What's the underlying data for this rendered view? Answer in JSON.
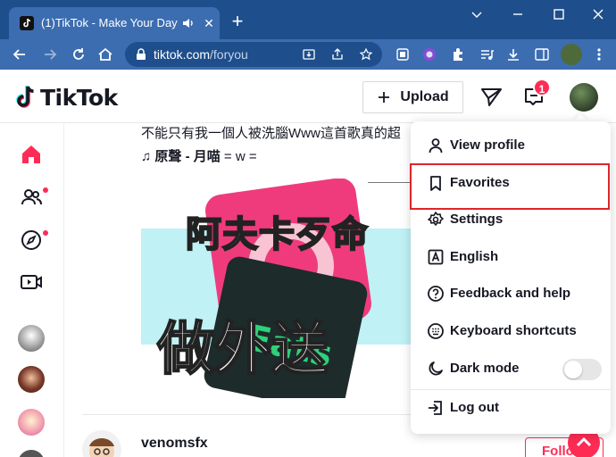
{
  "browser": {
    "tab": {
      "title": "(1)TikTok - Make Your Day",
      "favicon": "tiktok-icon",
      "audio_icon": "speaker-icon",
      "close_icon": "close-icon"
    },
    "new_tab_icon": "plus-icon",
    "window_controls": [
      "chevron-down-icon",
      "minimize-icon",
      "maximize-icon",
      "close-icon"
    ],
    "nav": [
      "back-arrow-icon",
      "forward-arrow-icon",
      "reload-icon",
      "home-icon"
    ],
    "url_host": "tiktok.com",
    "url_path": "/foryou",
    "omnibox_icons": [
      "install-icon",
      "share-icon",
      "bookmark-star-icon"
    ],
    "toolbar_icons": [
      "reader-icon",
      "extension-color-icon",
      "puzzle-icon",
      "media-icon",
      "download-icon",
      "sidepanel-icon",
      "profile-icon",
      "more-vert-icon"
    ]
  },
  "header": {
    "logo": "TikTok",
    "upload_label": "Upload",
    "inbox_badge": "1",
    "icons": [
      "plus-icon",
      "send-icon",
      "inbox-icon",
      "avatar"
    ]
  },
  "sidebar": {
    "items": [
      {
        "name": "home-icon",
        "active": true
      },
      {
        "name": "following-icon",
        "dot": true
      },
      {
        "name": "explore-icon",
        "dot": true
      },
      {
        "name": "live-icon"
      }
    ],
    "accounts": 4
  },
  "feed": {
    "caption": "不能只有我一個人被洗腦Www這首歌真的超",
    "sound_prefix": "♫ 原聲 - 月喵",
    "sound_suffix": "= w =",
    "video_text_top": "阿夫卡歹命",
    "video_text_bottom": "做外送",
    "next_username": "venomsfx",
    "follow_label": "Follow"
  },
  "menu": {
    "items": [
      {
        "label": "View profile",
        "icon": "person-icon"
      },
      {
        "label": "Favorites",
        "icon": "bookmark-icon",
        "highlighted": true
      },
      {
        "label": "Settings",
        "icon": "gear-icon"
      },
      {
        "label": "English",
        "icon": "language-icon"
      },
      {
        "label": "Feedback and help",
        "icon": "help-icon"
      },
      {
        "label": "Keyboard shortcuts",
        "icon": "keyboard-icon"
      },
      {
        "label": "Dark mode",
        "icon": "moon-icon",
        "toggle": false
      },
      {
        "label": "Log out",
        "icon": "logout-icon"
      }
    ]
  },
  "colors": {
    "brand": "#fe2c55",
    "chrome_frame": "#1e4e8c",
    "chrome_toolbar": "#3c6db0",
    "highlight_box": "#e0242a"
  }
}
